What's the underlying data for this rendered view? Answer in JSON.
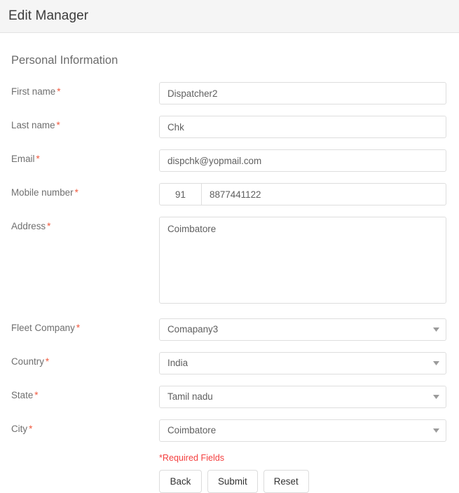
{
  "header": {
    "title": "Edit Manager"
  },
  "section": {
    "heading": "Personal Information"
  },
  "fields": {
    "first_name": {
      "label": "First name",
      "required_mark": "*",
      "value": "Dispatcher2",
      "placeholder": ""
    },
    "last_name": {
      "label": "Last name",
      "required_mark": "*",
      "value": "Chk",
      "placeholder": ""
    },
    "email": {
      "label": "Email",
      "required_mark": "*",
      "value": "dispchk@yopmail.com",
      "placeholder": ""
    },
    "mobile": {
      "label": "Mobile number",
      "required_mark": "*",
      "country_code": "91",
      "value": "8877441122",
      "placeholder": ""
    },
    "address": {
      "label": "Address",
      "required_mark": "*",
      "value": "Coimbatore",
      "placeholder": ""
    },
    "fleet_company": {
      "label": "Fleet Company",
      "required_mark": "*",
      "value": "Comapany3",
      "caret_icon": "chevron-down-icon"
    },
    "country": {
      "label": "Country",
      "required_mark": "*",
      "value": "India",
      "caret_icon": "chevron-down-icon"
    },
    "state": {
      "label": "State",
      "required_mark": "*",
      "value": "Tamil nadu",
      "caret_icon": "chevron-down-icon"
    },
    "city": {
      "label": "City",
      "required_mark": "*",
      "value": "Coimbatore",
      "caret_icon": "chevron-down-icon"
    }
  },
  "footer": {
    "required_note": "*Required Fields",
    "buttons": {
      "back": "Back",
      "submit": "Submit",
      "reset": "Reset"
    }
  },
  "colors": {
    "header_bg": "#f5f5f5",
    "label_text": "#6f6f6f",
    "required_star": "#f0593e",
    "required_note": "#f43f3f",
    "input_border": "#dedede",
    "value_text": "#5f5f5f"
  }
}
